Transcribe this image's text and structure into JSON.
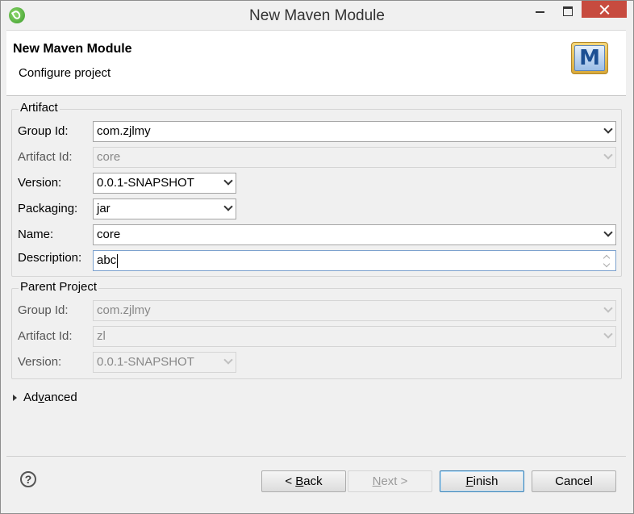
{
  "window": {
    "title": "New Maven Module"
  },
  "header": {
    "title": "New Maven Module",
    "subtitle": "Configure project",
    "icon_letter": "M",
    "icon": "maven-icon"
  },
  "artifact": {
    "legend": "Artifact",
    "group_id": {
      "label": "Group Id:",
      "value": "com.zjlmy"
    },
    "artifact_id": {
      "label": "Artifact Id:",
      "value": "core"
    },
    "version": {
      "label": "Version:",
      "value": "0.0.1-SNAPSHOT"
    },
    "packaging": {
      "label": "Packaging:",
      "value": "jar"
    },
    "name": {
      "label": "Name:",
      "value": "core"
    },
    "description": {
      "label": "Description:",
      "value": "abc"
    }
  },
  "parent": {
    "legend": "Parent Project",
    "group_id": {
      "label": "Group Id:",
      "value": "com.zjlmy"
    },
    "artifact_id": {
      "label": "Artifact Id:",
      "value": "zl"
    },
    "version": {
      "label": "Version:",
      "value": "0.0.1-SNAPSHOT"
    }
  },
  "advanced": {
    "pre": "Ad",
    "mnemonic": "v",
    "post": "anced"
  },
  "buttons": {
    "help": "?",
    "back": {
      "pre": "< ",
      "mnemonic": "B",
      "post": "ack"
    },
    "next": {
      "mnemonic": "N",
      "post": "ext >"
    },
    "finish": {
      "mnemonic": "F",
      "post": "inish"
    },
    "cancel": "Cancel"
  }
}
